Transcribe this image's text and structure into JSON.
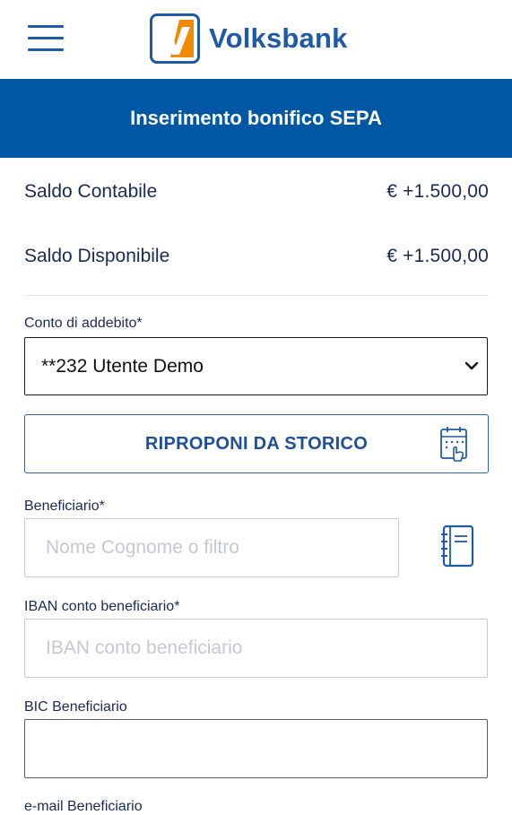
{
  "header": {
    "logo_letter": "V",
    "logo_text": "Volksbank",
    "brand_color": "#1e5aa8",
    "logo_accent": "#f08a00"
  },
  "title_bar": {
    "title": "Inserimento bonifico SEPA",
    "color": "#0058a4"
  },
  "balances": {
    "contabile_label": "Saldo Contabile",
    "contabile_value": "€ +1.500,00",
    "disponibile_label": "Saldo Disponibile",
    "disponibile_value": "€ +1.500,00"
  },
  "form": {
    "conto_label": "Conto di addebito*",
    "conto_value": "**232 Utente Demo",
    "storico_button": "RIPROPONI DA STORICO",
    "beneficiario_label": "Beneficiario*",
    "beneficiario_placeholder": "Nome Cognome o filtro",
    "iban_label": "IBAN conto beneficiario*",
    "iban_placeholder": "IBAN conto beneficiario",
    "bic_label": "BIC Beneficiario",
    "bic_value": "",
    "email_label": "e-mail Beneficiario"
  },
  "icons": {
    "menu": "hamburger-menu-icon",
    "select": "chevron-down-icon",
    "storico": "calendar-history-icon",
    "rubrica": "address-book-icon"
  }
}
